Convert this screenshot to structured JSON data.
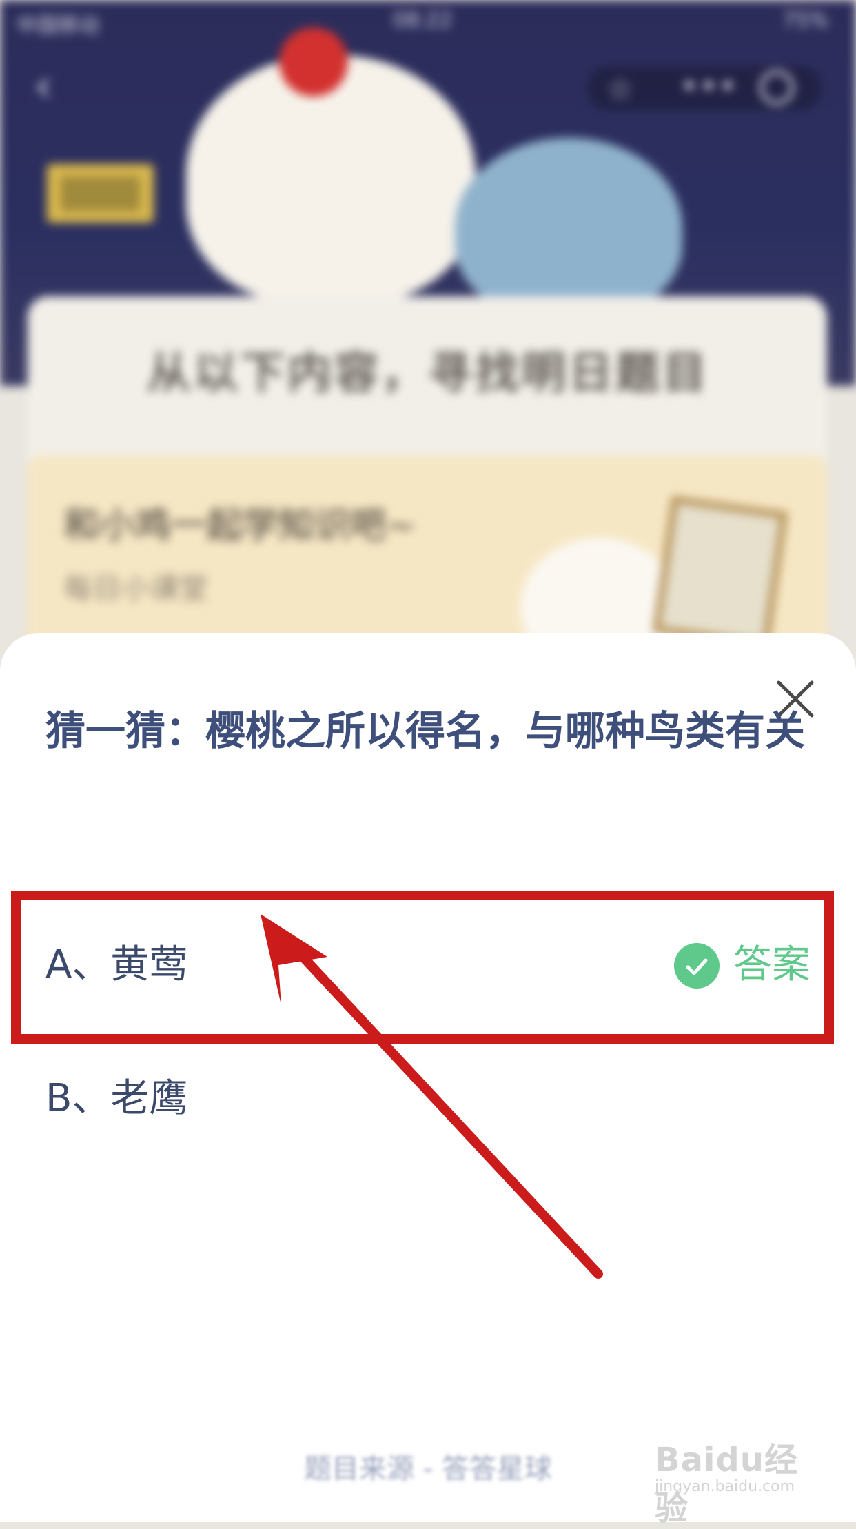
{
  "status_bar": {
    "carrier": "中国移动",
    "time": "08:22",
    "battery": "75%"
  },
  "background": {
    "headline": "从以下内容，寻找明日题目",
    "lesson_title": "和小鸡一起学知识吧~",
    "lesson_subtitle": "每日小课堂"
  },
  "quiz": {
    "question": "猜一猜：樱桃之所以得名，与哪种鸟类有关",
    "options": [
      {
        "label": "A、黄莺",
        "is_answer": true
      },
      {
        "label": "B、老鹰",
        "is_answer": false
      }
    ],
    "answer_label": "答案",
    "source": "题目来源 - 答答星球"
  },
  "watermark": {
    "logo": "Baidu经验",
    "url": "jingyan.baidu.com"
  },
  "colors": {
    "question_text": "#3d4f7a",
    "answer_green": "#5ec98a",
    "highlight_red": "#cc1b1b"
  },
  "icons": {
    "close": "close-icon",
    "check": "check-icon",
    "back": "back-arrow-icon"
  }
}
